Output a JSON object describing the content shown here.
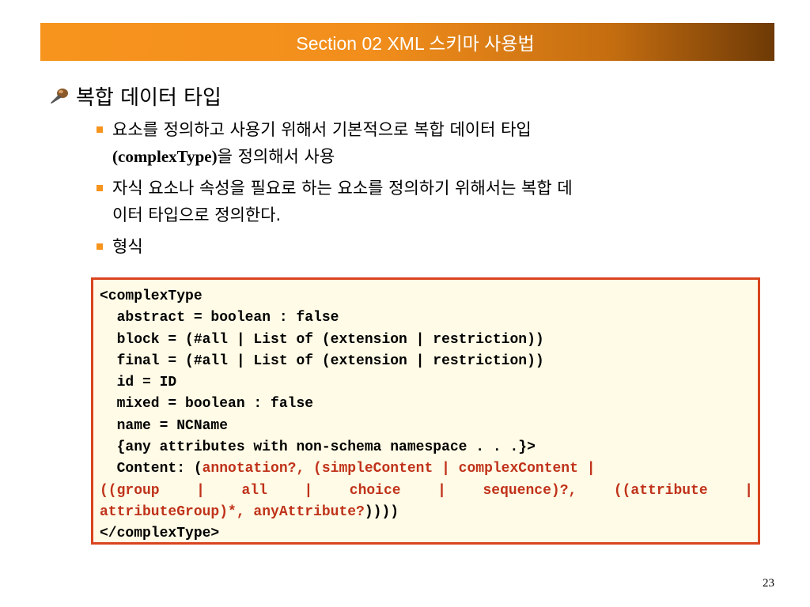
{
  "header": {
    "title": "Section 02 XML 스키마 사용법"
  },
  "heading": {
    "icon": "pushpin-icon",
    "text": "복합 데이터 타입"
  },
  "bullets": {
    "b1_line1": "요소를 정의하고 사용기 위해서 기본적으로 복합 데이터 타입",
    "b1_line2_term": "(complexType)",
    "b1_line2_rest": "을 정의해서 사용",
    "b2_line1": "자식 요소나 속성을 필요로 하는 요소를 정의하기 위해서는 복합 데",
    "b2_line2": "이터 타입으로 정의한다.",
    "b3": "형식"
  },
  "code": {
    "l1": "<complexType",
    "l2": "  abstract = boolean : false",
    "l3": "  block = (#all | List of (extension | restriction))",
    "l4": "  final = (#all | List of (extension | restriction))",
    "l5": "  id = ID",
    "l6": "  mixed = boolean : false",
    "l7": "  name = NCName",
    "l8": "  {any attributes with non-schema namespace . . .}>",
    "l9_black": "  Content: (",
    "l9_red": "annotation?, (simpleContent | complexContent |",
    "l10_red": "((group | all | choice | sequence)?, ((attribute |",
    "l11_red": "attributeGroup)*, anyAttribute?",
    "l11_black": "))))",
    "l12": "</complexType>"
  },
  "footer": {
    "page_number": "23"
  },
  "colors": {
    "accent": "#f7941d",
    "box_border": "#d9441e",
    "box_bg": "#fffbe6",
    "code_red": "#c0321a"
  }
}
